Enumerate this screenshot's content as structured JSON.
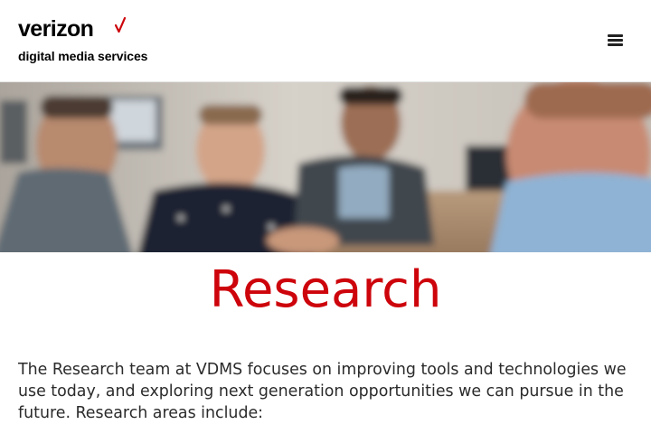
{
  "header": {
    "logo_wordmark": "verizon",
    "logo_subtitle": "digital media services",
    "menu_icon": "hamburger-menu-icon"
  },
  "hero": {
    "image_icon": "team-photo"
  },
  "main": {
    "title": "Research",
    "intro": "The Research team at VDMS focuses on improving tools and technologies we use today, and exploring next generation opportunities we can pursue in the future. Research areas include:"
  },
  "colors": {
    "brand_red": "#cd040b",
    "text": "#2b2b2b",
    "background": "#ffffff"
  }
}
